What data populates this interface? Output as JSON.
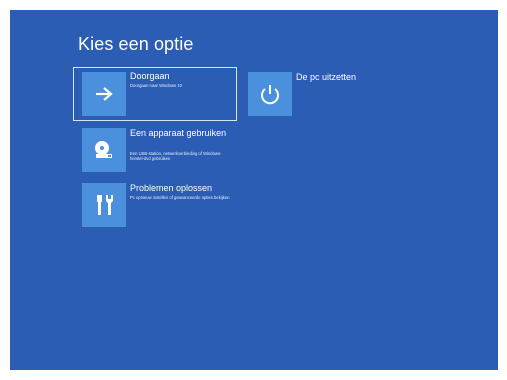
{
  "page": {
    "title": "Kies een optie"
  },
  "options": {
    "continue": {
      "label": "Doorgaan",
      "description": "Doorgaan naar Windows 10",
      "icon": "arrow-right-icon"
    },
    "use_device": {
      "label": "Een apparaat gebruiken",
      "description": "Een USB-station, netwerkverbinding of Windows-herstel-dvd gebruiken",
      "icon": "disc-drive-icon"
    },
    "troubleshoot": {
      "label": "Problemen oplossen",
      "description": "Pc opnieuw instellen of geavanceerde opties bekijken",
      "icon": "tools-icon"
    },
    "shutdown": {
      "label": "De pc uitzetten",
      "icon": "power-icon"
    }
  },
  "colors": {
    "background": "#2a5db3",
    "tile": "#4a90dc",
    "text": "#ffffff"
  }
}
